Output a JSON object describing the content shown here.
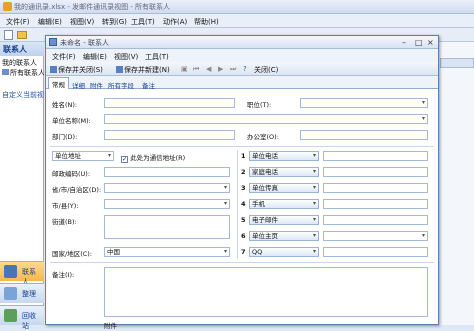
{
  "app": {
    "title": "我的通讯录.xlsx - 发邮件通讯录视图 - 所有联系人"
  },
  "main_menu": [
    "文件(F)",
    "编辑(E)",
    "视图(V)",
    "转到(G)",
    "工具(T)",
    "动作(A)",
    "帮助(H)"
  ],
  "sidebar": {
    "header": "联系人",
    "my_contacts": "我的联系人",
    "all_contacts": "所有联系人",
    "custom_view": "自定义当前视图...",
    "nav": [
      "联系人",
      "整理",
      "回收站"
    ]
  },
  "dialog": {
    "title": "未命名 - 联系人",
    "menu": [
      "文件(F)",
      "编辑(E)",
      "视图(V)",
      "工具(T)"
    ],
    "toolbar": {
      "save_close": "保存并关闭(S)",
      "save_new": "保存并新建(N)",
      "close": "关闭(C)"
    },
    "tabs": [
      "常规",
      "详细",
      "附件",
      "所有字段",
      "备注"
    ],
    "fields": {
      "name": "姓名(N):",
      "position": "职位(T):",
      "company": "单位名称(M):",
      "department": "部门(D):",
      "office": "办公室(O):",
      "address_type": "单位地址",
      "preferred_address": "此处为通信地址(R)",
      "postal_code": "邮政编码(U):",
      "province": "省/市/自治区(D):",
      "city": "市/县(Y):",
      "street": "街道(B):",
      "country": "国家/地区(C):",
      "country_value": "中国",
      "notes": "备注(I):",
      "bottom_label": "附件"
    },
    "phones": [
      {
        "n": "1",
        "label": "单位电话"
      },
      {
        "n": "2",
        "label": "家庭电话"
      },
      {
        "n": "3",
        "label": "单位传真"
      },
      {
        "n": "4",
        "label": "手机"
      },
      {
        "n": "5",
        "label": "电子邮件"
      },
      {
        "n": "6",
        "label": "单位主页"
      },
      {
        "n": "7",
        "label": "QQ"
      }
    ]
  }
}
